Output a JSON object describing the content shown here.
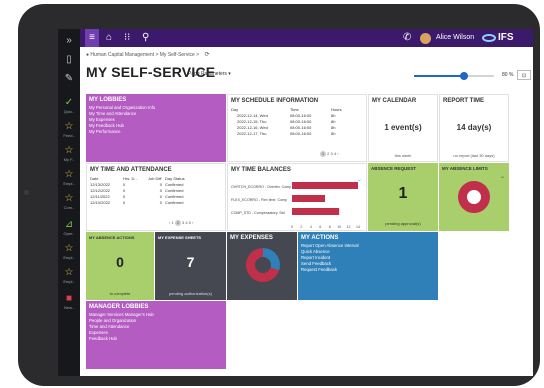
{
  "topbar": {
    "user_name": "Alice Wilson",
    "brand": "IFS"
  },
  "breadcrumb": "Human Capital Management > My Self-Service >",
  "page": {
    "title": "MY SELF-SERVICE",
    "page_parameters": "Page Parameters ▾",
    "zoom": "80 %",
    "zoom_fraction": 0.62
  },
  "rail": {
    "labels": [
      "Quic..",
      "Feed..",
      "My F..",
      "Empl..",
      "Com..",
      "Oper..",
      "Empl..",
      "Empl..",
      "New.."
    ]
  },
  "tiles": {
    "lobbies": {
      "title": "MY LOBBIES",
      "items": [
        "My Personal and Organization Info",
        "My Time and Attendance",
        "My Expenses",
        "My Feedback Hub",
        "My Performance"
      ]
    },
    "schedule": {
      "title": "MY SCHEDULE INFORMATION",
      "headers": [
        "Day",
        "Time",
        "Hours"
      ],
      "rows": [
        [
          "2022-12-14, Wed",
          "08:00-16:00",
          "8h"
        ],
        [
          "2022-12-15, Thu",
          "08:00-16:00",
          "8h"
        ],
        [
          "2022-12-16, Wed",
          "08:00-16:00",
          "8h"
        ],
        [
          "2022-12-17, Thu",
          "08:00-16:00",
          "8h"
        ]
      ],
      "pager": [
        "1",
        "2",
        "3",
        "4",
        "›"
      ]
    },
    "calendar": {
      "title": "MY CALENDAR",
      "value": "1 event(s)",
      "sub": "this week"
    },
    "report": {
      "title": "REPORT TIME",
      "value": "14 day(s)",
      "sub": "no report (last 30 days)"
    },
    "time_att": {
      "title": "MY TIME AND ATTENDANCE",
      "headers": [
        "Date",
        "Hrs. D...",
        "Job Diff",
        "Day Status"
      ],
      "rows": [
        [
          "12/13/2022",
          "0",
          "0",
          "Confirmed"
        ],
        [
          "12/12/2022",
          "0",
          "0",
          "Confirmed"
        ],
        [
          "12/11/2022",
          "0",
          "0",
          "Confirmed"
        ],
        [
          "12/10/2022",
          "0",
          "0",
          "Confirmed"
        ]
      ],
      "pager": [
        "‹",
        "1",
        "2",
        "3",
        "4",
        "5",
        "›"
      ]
    },
    "balances": {
      "title": "MY TIME BALANCES",
      "categories": [
        "OVRTCH_ECORRO - Overtim. Comp",
        "FLEX_ECORRO - Flex time. Comp",
        "COMP_STD - Compensatory. Std"
      ],
      "values": [
        14,
        7,
        10
      ],
      "ticks": [
        "0",
        "2",
        "4",
        "6",
        "8",
        "10",
        "12",
        "14"
      ],
      "xmax": 14,
      "bar_color": "#c0304a"
    },
    "absence_request": {
      "title": "ABSENCE REQUEST",
      "value": "1",
      "sub": "pending approval(s)"
    },
    "absence_limits": {
      "title": "MY ABSENCE LIMITS",
      "ring_color": "#c0304a"
    },
    "absence_actions": {
      "title": "MY ABSENCE ACTIONS",
      "value": "0",
      "sub": "to complete"
    },
    "expense_sheets": {
      "title": "MY EXPENSE SHEETS",
      "value": "7",
      "sub": "pending authorization(s)"
    },
    "expenses": {
      "title": "MY EXPENSES"
    },
    "actions": {
      "title": "MY ACTIONS",
      "items": [
        "Report Open Absence Interval",
        "Quick Absence",
        "Report Incident",
        "Send Feedback",
        "Request Feedback"
      ]
    },
    "manager": {
      "title": "MANAGER LOBBIES",
      "items": [
        "Manager Services Manager's Hub",
        "People and Organization",
        "Time and Attendance",
        "Expenses",
        "Feedback Hub"
      ]
    }
  },
  "colors": {
    "topbar": "#3b1a6b",
    "purple": "#b45cc2",
    "green": "#a8cf6c",
    "gray": "#454851",
    "blue": "#2f7fb8",
    "rail_green": "#7ac943",
    "rail_yellow": "#e6c34a"
  }
}
